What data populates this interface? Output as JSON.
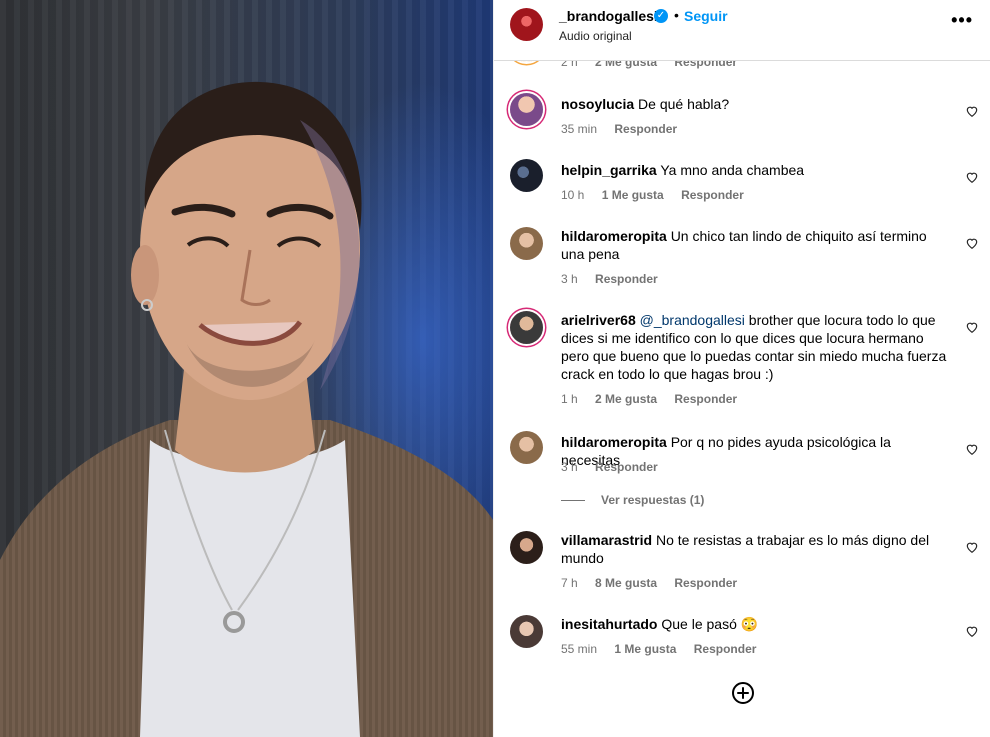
{
  "header": {
    "username": "_brandogallesi",
    "follow_label": "Seguir",
    "dot": "•",
    "audio": "Audio original",
    "more_icon": "more-horizontal-icon"
  },
  "partial_comment": {
    "time": "2 h",
    "likes": "2 Me gusta",
    "reply": "Responder"
  },
  "comments": [
    {
      "user": "nosoylucia",
      "text": "De qué habla?",
      "time": "35 min",
      "likes": "",
      "reply": "Responder"
    },
    {
      "user": "helpin_garrika",
      "text": "Ya mno anda chambea",
      "time": "10 h",
      "likes": "1 Me gusta",
      "reply": "Responder"
    },
    {
      "user": "hildaromeropita",
      "text": "Un chico tan lindo de chiquito así termino una pena",
      "time": "3 h",
      "likes": "",
      "reply": "Responder"
    },
    {
      "user": "arielriver68",
      "mention": "@_brandogallesi",
      "text": "brother que locura todo lo que dices si me identifico con lo que dices que locura hermano pero que bueno que lo puedas contar sin miedo mucha fuerza crack en todo lo que hagas brou :)",
      "time": "1 h",
      "likes": "2 Me gusta",
      "reply": "Responder"
    },
    {
      "user": "hildaromeropita",
      "text": "Por q no pides ayuda psicológica la necesitas",
      "time": "3 h",
      "likes": "",
      "reply": "Responder",
      "view_replies": "Ver respuestas (1)"
    },
    {
      "user": "villamarastrid",
      "text": "No te resistas a trabajar es lo más digno del mundo",
      "time": "7 h",
      "likes": "8 Me gusta",
      "reply": "Responder"
    },
    {
      "user": "inesitahurtado",
      "text": "Que le pasó 😳",
      "time": "55 min",
      "likes": "1 Me gusta",
      "reply": "Responder"
    }
  ],
  "add_comment_icon": "plus-circle-icon",
  "colors": {
    "accent": "#0095f6",
    "meta": "#737373",
    "mention": "#00376b",
    "divider": "#dbdbdb"
  }
}
